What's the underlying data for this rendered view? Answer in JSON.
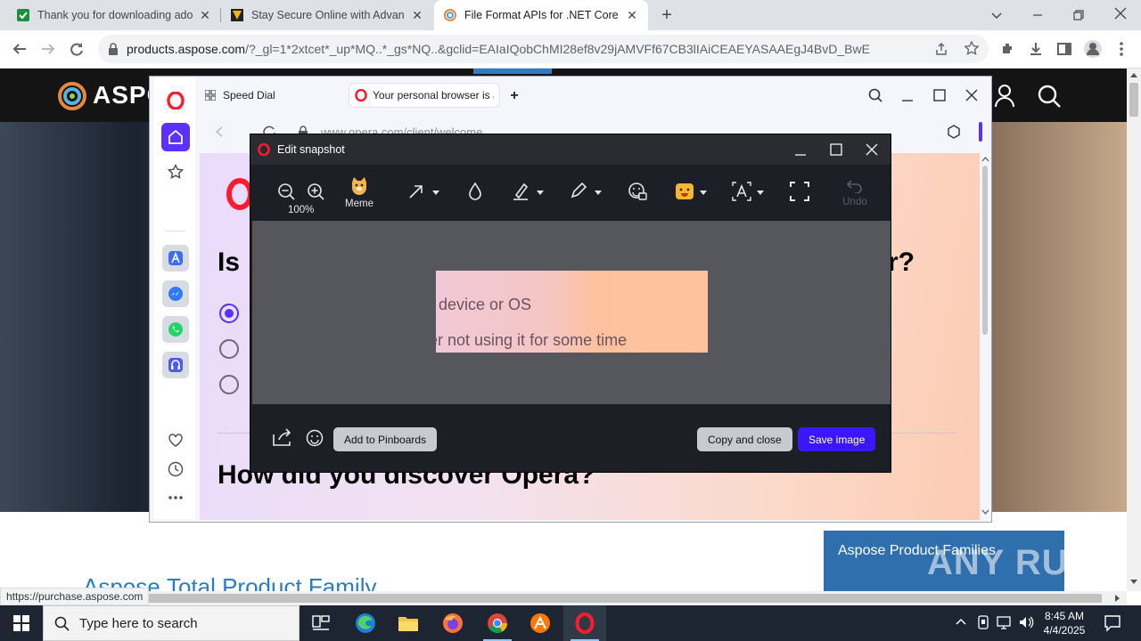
{
  "chrome": {
    "tabs": [
      {
        "title": "Thank you for downloading ado",
        "favicon": "green-check-icon",
        "active": false
      },
      {
        "title": "Stay Secure Online with Advanc",
        "favicon": "shield-logo-icon",
        "active": false
      },
      {
        "title": "File Format APIs for .NET Core, J",
        "favicon": "aspose-logo-icon",
        "active": true
      }
    ],
    "new_tab": "+",
    "address": {
      "host": "products.aspose.com",
      "path": "/?_gl=1*2xtcet*_up*MQ..*_gs*NQ..&gclid=EAIaIQobChMI28ef8v29jAMVFf67CB3lIAiCEAEYASAAEgJ4BvD_BwE"
    },
    "status_url": "https://purchase.aspose.com"
  },
  "page": {
    "logo_text": "ASPO",
    "family_title": "Aspose.Total Product Family",
    "families_box_label": "Aspose Product Families"
  },
  "opera": {
    "tabs": [
      {
        "title": "Speed Dial",
        "icon": "grid-icon"
      },
      {
        "title": "Your personal browser is a",
        "icon": "opera-logo-icon"
      }
    ],
    "url": "www.opera.com/client/welcome",
    "survey": {
      "q1_left": "Is",
      "q1_right": "r?",
      "q2": "How did you discover Opera?"
    }
  },
  "snapshot": {
    "title": "Edit snapshot",
    "zoom": "100%",
    "tools": {
      "meme": "Meme",
      "undo": "Undo"
    },
    "image_lines": [
      "r device or OS",
      "er not using it for some time"
    ],
    "buttons": {
      "pinboards": "Add to Pinboards",
      "copy_close": "Copy and close",
      "save": "Save image"
    }
  },
  "taskbar": {
    "search_placeholder": "Type here to search",
    "time": "8:45 AM",
    "date": "4/4/2025"
  },
  "watermark": "ANY RUN",
  "colors": {
    "opera_accent": "#5c30ff",
    "save_button": "#3b17ff",
    "aspose_header": "#141414",
    "taskbar": "#1c2531"
  }
}
